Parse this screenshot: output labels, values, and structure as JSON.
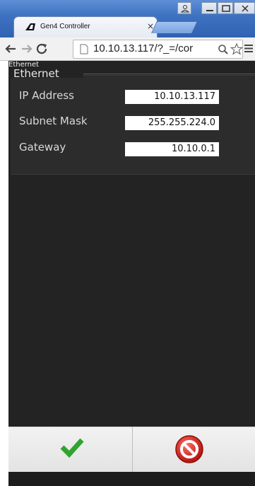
{
  "browser": {
    "tab_title": "Gen4 Controller",
    "tab_close": "×",
    "url": "10.10.13.117/?_=/cor"
  },
  "page": {
    "label": "Ethernet"
  },
  "ethernet": {
    "legend": "Ethernet",
    "fields": [
      {
        "label": "IP Address",
        "value": "10.10.13.117"
      },
      {
        "label": "Subnet Mask",
        "value": "255.255.224.0"
      },
      {
        "label": "Gateway",
        "value": "10.10.0.1"
      }
    ]
  },
  "colors": {
    "ok": "#2fa52f",
    "cancel": "#c8201e",
    "app_background": "#232323"
  },
  "icons": {
    "ok": "checkmark-icon",
    "cancel": "no-entry-icon"
  }
}
